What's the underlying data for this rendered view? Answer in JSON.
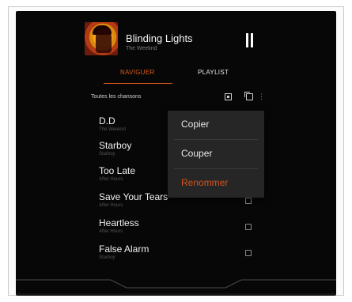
{
  "now_playing": {
    "title": "Blinding Lights",
    "artist": "The Weeknd"
  },
  "tabs": [
    {
      "label": "NAVIGUER",
      "active": true
    },
    {
      "label": "PLAYLIST",
      "active": false
    }
  ],
  "list_header": {
    "label": "Toutes les chansons"
  },
  "songs": [
    {
      "title": "D.D",
      "artist": "The Weeknd"
    },
    {
      "title": "Starboy",
      "artist": "Starboy"
    },
    {
      "title": "Too Late",
      "artist": "After Hours"
    },
    {
      "title": "Save Your Tears",
      "artist": "After Hours"
    },
    {
      "title": "Heartless",
      "artist": "After Hours"
    },
    {
      "title": "False Alarm",
      "artist": "Starboy"
    }
  ],
  "context_menu": {
    "items": [
      {
        "label": "Copier"
      },
      {
        "label": "Couper"
      },
      {
        "label": "Renommer"
      }
    ]
  },
  "colors": {
    "accent": "#d95c1a",
    "background": "#070707",
    "menu": "#262626"
  },
  "icons": {
    "pause": "pause-icon",
    "grid": "select-grid-icon",
    "copy": "copy-icon",
    "more": "more-vertical-icon",
    "checkbox": "checkbox-icon"
  }
}
